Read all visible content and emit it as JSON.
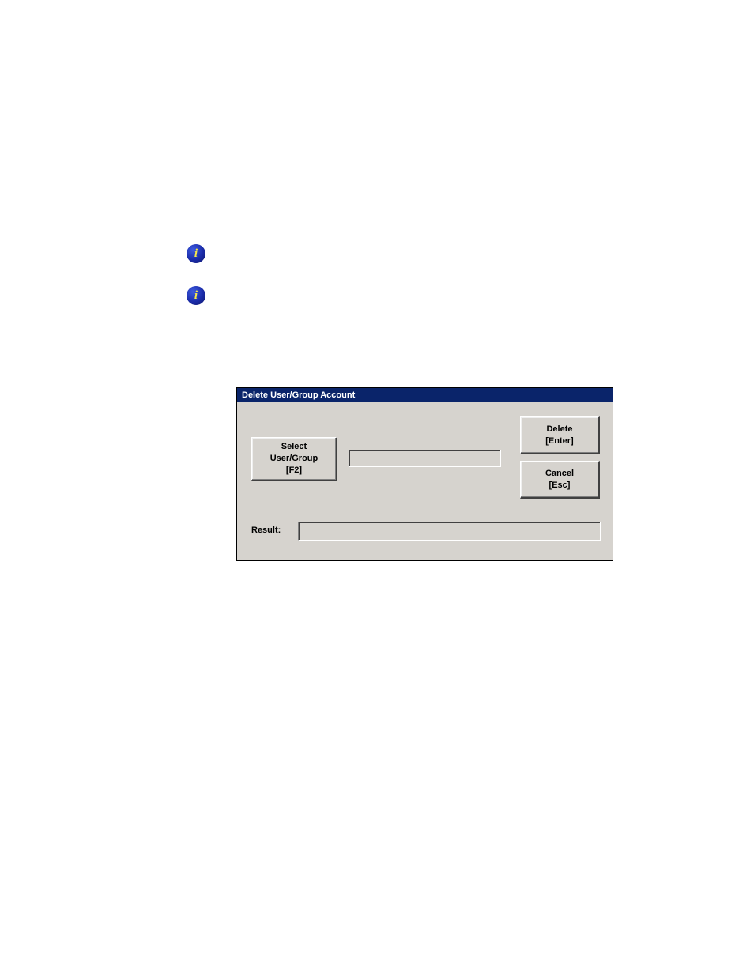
{
  "icons": {
    "info_char": "i"
  },
  "dialog": {
    "title": "Delete User/Group Account",
    "select_button": {
      "line1": "Select",
      "line2": "User/Group",
      "line3": "[F2]"
    },
    "usergroup_value": "",
    "delete_button": {
      "line1": "Delete",
      "line2": "[Enter]"
    },
    "cancel_button": {
      "line1": "Cancel",
      "line2": "[Esc]"
    },
    "result_label": "Result:",
    "result_value": ""
  }
}
